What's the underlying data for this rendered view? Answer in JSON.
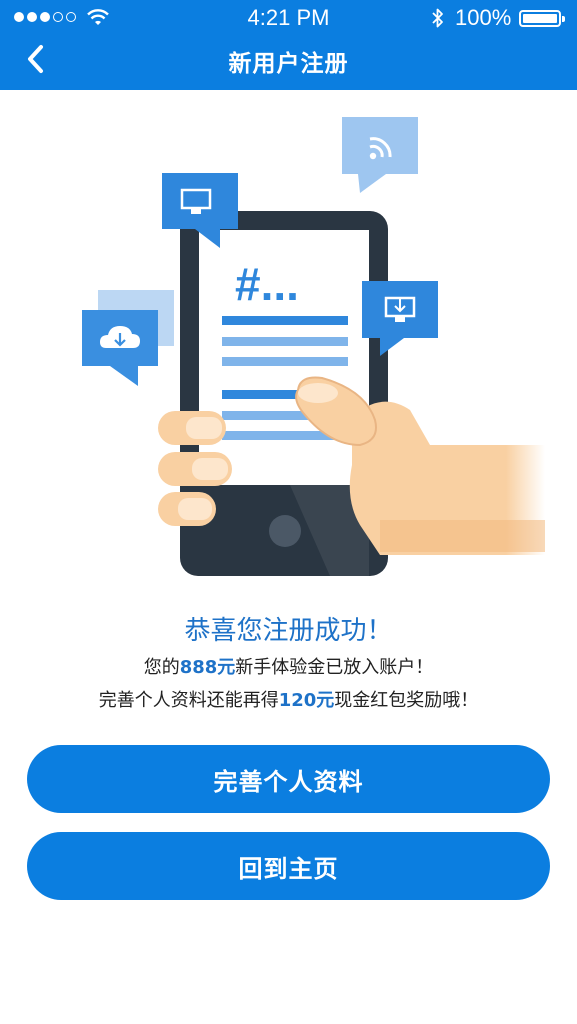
{
  "status_bar": {
    "time": "4:21 PM",
    "battery": "100%",
    "icons": [
      "signal-dots",
      "wifi-icon",
      "bluetooth-icon",
      "battery-icon"
    ]
  },
  "nav": {
    "title": "新用户注册",
    "back_icon": "chevron-left-icon"
  },
  "illustration": {
    "screen_text": "#...",
    "icons": [
      "cloud-download-icon",
      "monitor-icon",
      "rss-icon",
      "download-screen-icon"
    ]
  },
  "message": {
    "title": "恭喜您注册成功！",
    "line1_prefix": "您的",
    "line1_amount": "888元",
    "line1_suffix": "新手体验金已放入账户！",
    "line2_prefix": "完善个人资料还能再得",
    "line2_amount": "120元",
    "line2_suffix": "现金红包奖励哦！"
  },
  "buttons": {
    "complete_profile": "完善个人资料",
    "back_home": "回到主页"
  },
  "colors": {
    "primary": "#0b7ee0",
    "highlight": "#1e72c8"
  }
}
